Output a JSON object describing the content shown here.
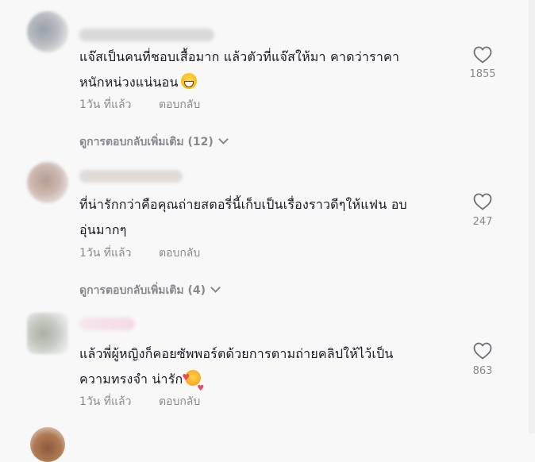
{
  "comments": [
    {
      "text_line1": "แจ๊สเป็นคนที่ชอบเสื้อมาก แล้วตัวที่แจ๊สให้มา คาดว่าราคา",
      "text_line2": "หนักหน่วงแน่นอน",
      "emoji": "grinning-face-emoji",
      "time": "1วัน ที่แล้ว",
      "reply_label": "ตอบกลับ",
      "likes": "1855",
      "view_more": "ดูการตอบกลับเพิ่มเติม (12)"
    },
    {
      "text_line1": "ที่น่ารักกว่าคือคุณถ่ายสตอรี่นี้เก็บเป็นเรื่องราวดีๆให้แฟน อบ",
      "text_line2": "อุ่นมากๆ",
      "time": "1วัน ที่แล้ว",
      "reply_label": "ตอบกลับ",
      "likes": "247",
      "view_more": "ดูการตอบกลับเพิ่มเติม (4)"
    },
    {
      "text_line1": "แล้วพี่ผู้หญิงก็คอยซัพพอร์ตด้วยการตามถ่ายคลิปให้ไว้เป็น",
      "text_line2": "ความทรงจำ น่ารัก",
      "emoji": "smiling-face-with-hearts-emoji",
      "time": "1วัน ที่แล้ว",
      "reply_label": "ตอบกลับ",
      "likes": "863"
    }
  ],
  "colors": {
    "background": "#f8f8f8",
    "text": "#161823",
    "muted": "rgba(22,24,35,0.5)"
  },
  "icons": {
    "like": "heart-outline-icon",
    "expand": "chevron-down-icon"
  }
}
